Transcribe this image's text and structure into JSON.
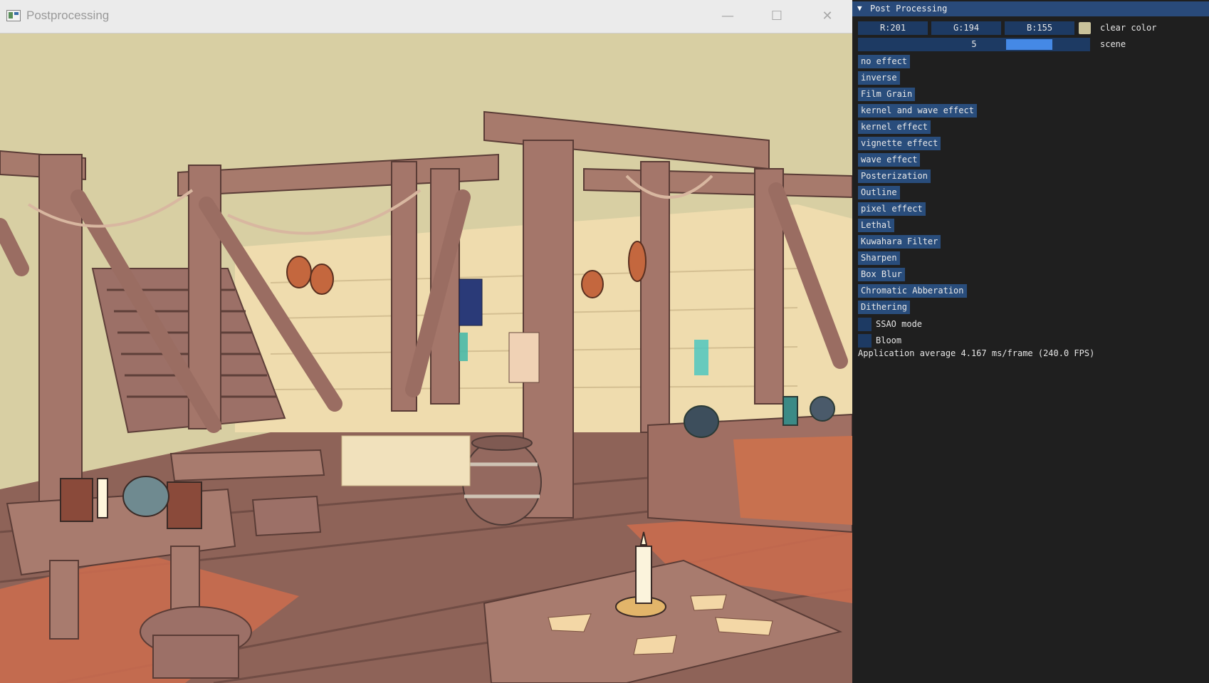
{
  "window": {
    "title": "Postprocessing",
    "minimize_glyph": "—",
    "maximize_glyph": "☐",
    "close_glyph": "✕"
  },
  "panel": {
    "title": "Post Processing",
    "collapse_arrow": "▼",
    "clear_color": {
      "r": "R:201",
      "g": "G:194",
      "b": "B:155",
      "label": "clear color",
      "swatch_hex": "#c9c29b"
    },
    "scene": {
      "value": "5",
      "label": "scene",
      "level_fraction": 0.8
    },
    "buttons": [
      "no effect",
      "inverse",
      "Film Grain",
      "kernel and wave effect",
      "kernel effect",
      "vignette effect",
      "wave effect",
      "Posterization",
      "Outline",
      "pixel effect",
      "Lethal",
      "Kuwahara Filter",
      "Sharpen",
      "Box Blur",
      "Chromatic Abberation",
      "Dithering"
    ],
    "checkboxes": [
      {
        "label": "SSAO mode",
        "checked": false
      },
      {
        "label": "Bloom",
        "checked": false
      }
    ],
    "status": "Application average 4.167 ms/frame (240.0 FPS)"
  },
  "colors": {
    "sky": "#d8cfa3",
    "wood": "#a8786a",
    "wood_dark": "#6e4c46",
    "wall": "#f0dfb5",
    "floor": "#c86a4e",
    "accent_button": "#294d7c",
    "frame_bg": "#1d3a63"
  }
}
